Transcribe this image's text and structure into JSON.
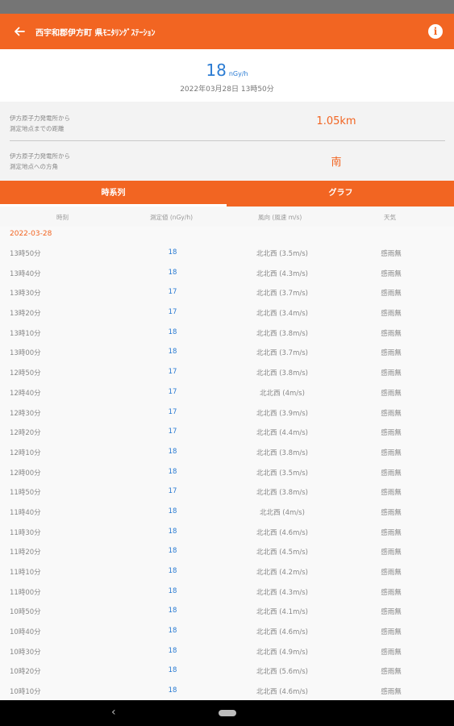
{
  "app_bar": {
    "title": "西宇和郡伊方町 県ﾓﾆﾀﾘﾝｸﾞｽﾃｰｼｮﾝ",
    "back_icon": "arrow-left-icon",
    "info_icon": "info-icon",
    "color": "#f26522"
  },
  "summary": {
    "dose_value": "18",
    "dose_unit": "nGy/h",
    "measured_at": "2022年03月28日 13時50分"
  },
  "info": {
    "distance_label": "伊方原子力発電所から\n測定地点までの距離",
    "distance_value": "1.05km",
    "direction_label": "伊方原子力発電所から\n測定地点への方角",
    "direction_value": "南"
  },
  "tabs": [
    {
      "label": "時系列",
      "selected": true
    },
    {
      "label": "グラフ",
      "selected": false
    }
  ],
  "columns": {
    "time": "時刻",
    "dose": "測定値 (nGy/h)",
    "wind": "風向 (風速 m/s)",
    "weather": "天気"
  },
  "date_header": "2022-03-28",
  "rows": [
    {
      "time": "13時50分",
      "dose": "18",
      "wind": "北北西 (3.5m/s)",
      "weather": "感雨無"
    },
    {
      "time": "13時40分",
      "dose": "18",
      "wind": "北北西 (4.3m/s)",
      "weather": "感雨無"
    },
    {
      "time": "13時30分",
      "dose": "17",
      "wind": "北北西 (3.7m/s)",
      "weather": "感雨無"
    },
    {
      "time": "13時20分",
      "dose": "17",
      "wind": "北北西 (3.4m/s)",
      "weather": "感雨無"
    },
    {
      "time": "13時10分",
      "dose": "18",
      "wind": "北北西 (3.8m/s)",
      "weather": "感雨無"
    },
    {
      "time": "13時00分",
      "dose": "18",
      "wind": "北北西 (3.7m/s)",
      "weather": "感雨無"
    },
    {
      "time": "12時50分",
      "dose": "17",
      "wind": "北北西 (3.8m/s)",
      "weather": "感雨無"
    },
    {
      "time": "12時40分",
      "dose": "17",
      "wind": "北北西 (4m/s)",
      "weather": "感雨無"
    },
    {
      "time": "12時30分",
      "dose": "17",
      "wind": "北北西 (3.9m/s)",
      "weather": "感雨無"
    },
    {
      "time": "12時20分",
      "dose": "17",
      "wind": "北北西 (4.4m/s)",
      "weather": "感雨無"
    },
    {
      "time": "12時10分",
      "dose": "18",
      "wind": "北北西 (3.8m/s)",
      "weather": "感雨無"
    },
    {
      "time": "12時00分",
      "dose": "18",
      "wind": "北北西 (3.5m/s)",
      "weather": "感雨無"
    },
    {
      "time": "11時50分",
      "dose": "17",
      "wind": "北北西 (3.8m/s)",
      "weather": "感雨無"
    },
    {
      "time": "11時40分",
      "dose": "18",
      "wind": "北北西 (4m/s)",
      "weather": "感雨無"
    },
    {
      "time": "11時30分",
      "dose": "18",
      "wind": "北北西 (4.6m/s)",
      "weather": "感雨無"
    },
    {
      "time": "11時20分",
      "dose": "18",
      "wind": "北北西 (4.5m/s)",
      "weather": "感雨無"
    },
    {
      "time": "11時10分",
      "dose": "18",
      "wind": "北北西 (4.2m/s)",
      "weather": "感雨無"
    },
    {
      "time": "11時00分",
      "dose": "18",
      "wind": "北北西 (4.3m/s)",
      "weather": "感雨無"
    },
    {
      "time": "10時50分",
      "dose": "18",
      "wind": "北北西 (4.1m/s)",
      "weather": "感雨無"
    },
    {
      "time": "10時40分",
      "dose": "18",
      "wind": "北北西 (4.6m/s)",
      "weather": "感雨無"
    },
    {
      "time": "10時30分",
      "dose": "18",
      "wind": "北北西 (4.9m/s)",
      "weather": "感雨無"
    },
    {
      "time": "10時20分",
      "dose": "18",
      "wind": "北北西 (5.6m/s)",
      "weather": "感雨無"
    },
    {
      "time": "10時10分",
      "dose": "18",
      "wind": "北北西 (4.6m/s)",
      "weather": "感雨無"
    }
  ],
  "nav": {
    "back_icon": "nav-back-icon",
    "home_icon": "nav-home-icon"
  }
}
